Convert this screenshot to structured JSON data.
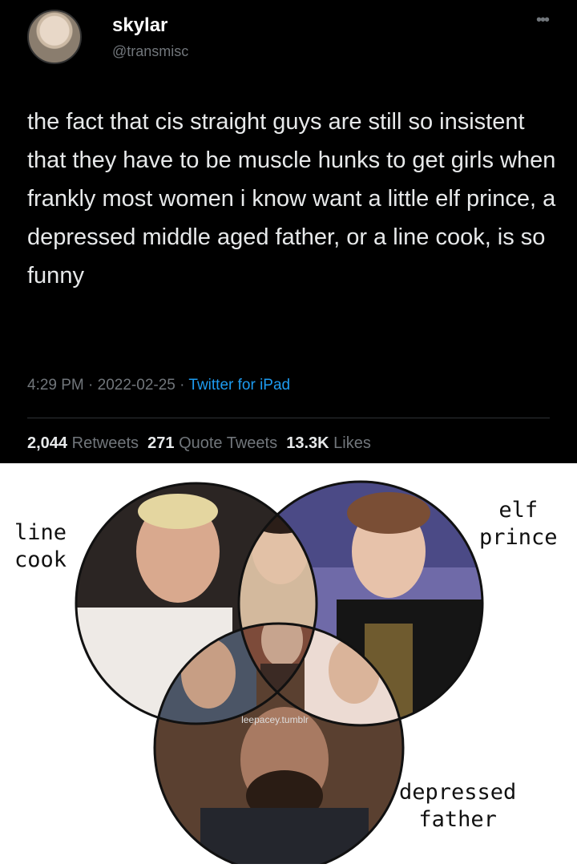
{
  "tweet": {
    "display_name": "skylar",
    "handle": "@transmisc",
    "more_icon": "ellipsis-icon",
    "text": "the fact that cis straight guys are still so insistent that they have to be muscle hunks to get girls when frankly most women i know want a little elf prince, a depressed middle aged father, or a line cook, is so funny",
    "time": "4:29 PM",
    "date": "2022-02-25",
    "source": "Twitter for iPad",
    "retweets_count": "2,044",
    "retweets_label": "Retweets",
    "quotes_count": "271",
    "quotes_label": "Quote Tweets",
    "likes_count": "13.3K",
    "likes_label": "Likes"
  },
  "venn": {
    "label_line1": "line",
    "label_line2": "cook",
    "label_elf1": "elf",
    "label_elf2": "prince",
    "label_dep1": "depressed",
    "label_dep2": "father",
    "watermark": "leepacey.tumblr"
  },
  "colors": {
    "background": "#000000",
    "link": "#1d9bf0",
    "muted": "#71767b"
  }
}
